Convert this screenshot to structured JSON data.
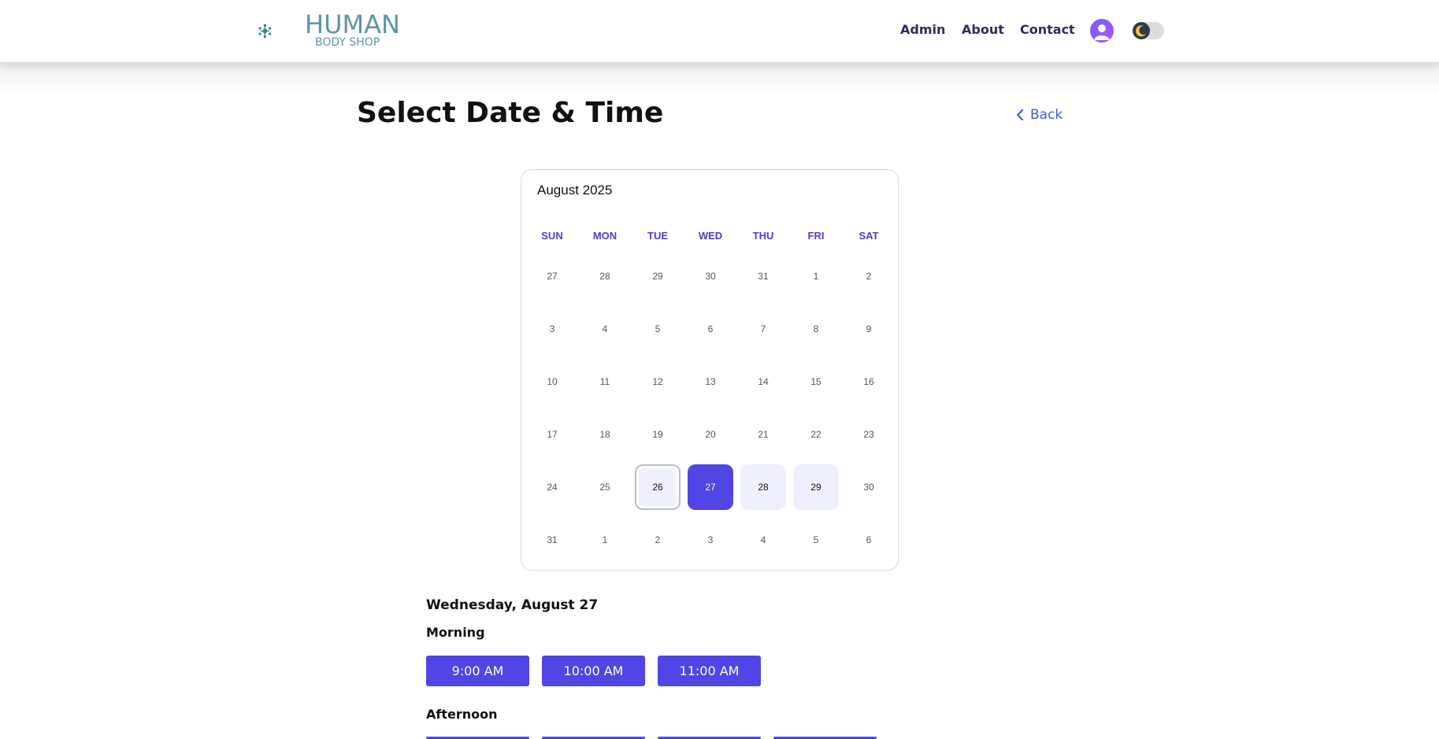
{
  "header": {
    "logo_line1": "HUMAN",
    "logo_line2": "BODY SHOP",
    "nav": [
      "Admin",
      "About",
      "Contact"
    ],
    "icons": [
      "user-avatar-icon",
      "moon-icon"
    ]
  },
  "page": {
    "title": "Select Date & Time",
    "back_label": "Back"
  },
  "calendar": {
    "month_label": "August 2025",
    "weekdays": [
      "SUN",
      "MON",
      "TUE",
      "WED",
      "THU",
      "FRI",
      "SAT"
    ],
    "weeks": [
      [
        "27",
        "28",
        "29",
        "30",
        "31",
        "1",
        "2"
      ],
      [
        "3",
        "4",
        "5",
        "6",
        "7",
        "8",
        "9"
      ],
      [
        "10",
        "11",
        "12",
        "13",
        "14",
        "15",
        "16"
      ],
      [
        "17",
        "18",
        "19",
        "20",
        "21",
        "22",
        "23"
      ],
      [
        "24",
        "25",
        "26",
        "27",
        "28",
        "29",
        "30"
      ],
      [
        "31",
        "1",
        "2",
        "3",
        "4",
        "5",
        "6"
      ]
    ],
    "today": "26",
    "selected": "27",
    "available": [
      "26",
      "27",
      "28",
      "29"
    ],
    "colors": {
      "accent": "#4f46e5",
      "available_bg": "#eef1fd"
    }
  },
  "slots": {
    "selected_date_label": "Wednesday, August 27",
    "morning_label": "Morning",
    "morning": [
      "9:00 AM",
      "10:00 AM",
      "11:00 AM"
    ],
    "afternoon_label": "Afternoon"
  }
}
